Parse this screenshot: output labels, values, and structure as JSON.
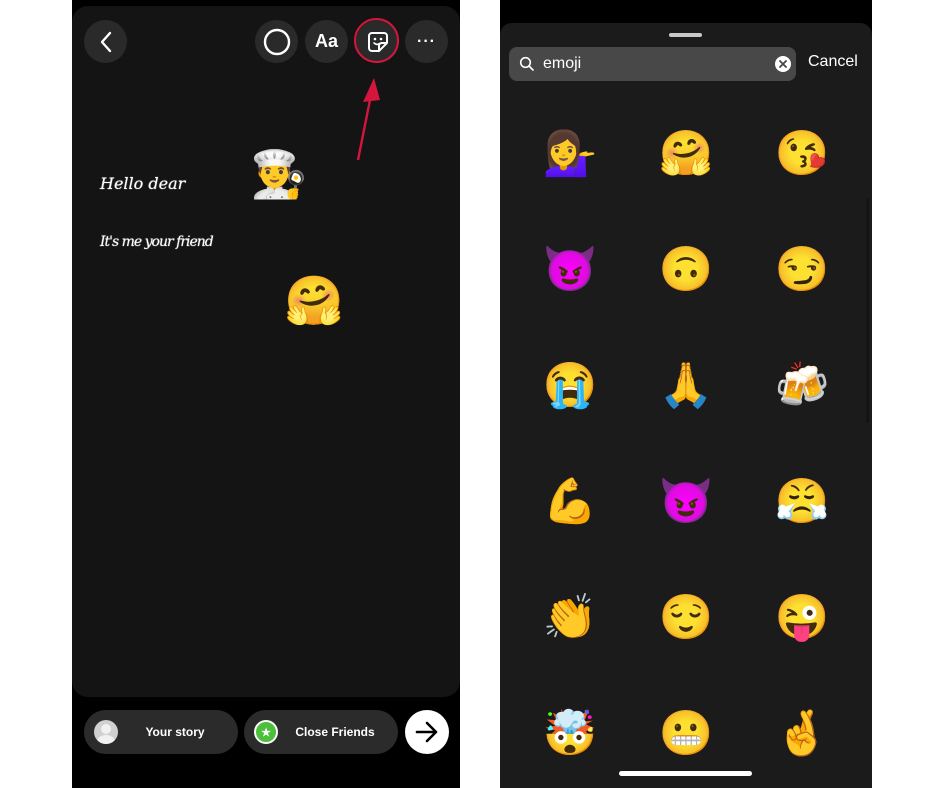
{
  "editor": {
    "toolbar": {
      "back_icon": "chevron-left-icon",
      "draw_icon": "circle-icon",
      "text_label": "Aa",
      "sticker_icon": "sticker-icon",
      "more_label": "···"
    },
    "highlight_color": "#d4163c",
    "canvas": {
      "texts": [
        "Hello dear",
        "It's me your friend"
      ],
      "stickers": [
        "👨‍🍳",
        "🤗"
      ]
    },
    "bottom": {
      "your_story_label": "Your story",
      "close_friends_label": "Close Friends",
      "close_friends_icon": "★",
      "close_friends_color": "#4cc03a"
    }
  },
  "sticker_search": {
    "query": "emoji",
    "cancel_label": "Cancel",
    "results": [
      "💁‍♀️",
      "🤗",
      "😘",
      "😈",
      "🙃",
      "😏",
      "😭",
      "🙏",
      "🍻",
      "💪",
      "😈",
      "😤",
      "👏",
      "😌",
      "😜",
      "🤯",
      "😬",
      "🤞"
    ]
  }
}
